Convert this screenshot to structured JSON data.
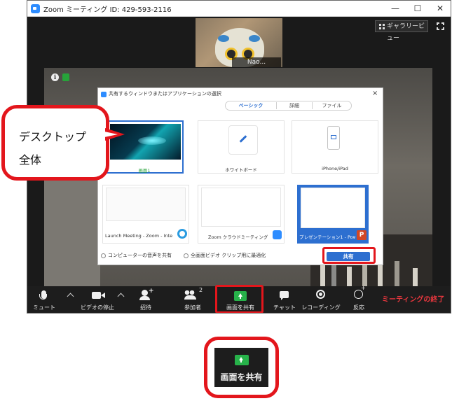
{
  "window": {
    "title": "Zoom ミーティング ID: 429-593-2116",
    "minimize": "—",
    "maximize": "☐",
    "close": "✕"
  },
  "gallery_view_label": "ギャラリービュー",
  "participant": {
    "name": "Nao..."
  },
  "share_dialog": {
    "title": "共有するウィンドウまたはアプリケーションの選択",
    "close": "×",
    "tabs": [
      "ベーシック",
      "詳細",
      "ファイル"
    ],
    "tiles": [
      {
        "label": "画面1"
      },
      {
        "label": "ホワイトボード"
      },
      {
        "label": "iPhone/iPad"
      },
      {
        "label": "Launch Meeting - Zoom - Intern..."
      },
      {
        "label": "Zoom クラウドミーティング"
      },
      {
        "label": "プレゼンテーション1 - Pow..."
      }
    ],
    "ppt_glyph": "P",
    "options": {
      "share_audio": "コンピューターの音声を共有",
      "optimize_video": "全画面ビデオ クリップ用に最適化"
    },
    "share_button": "共有"
  },
  "toolbar": {
    "mute": "ミュート",
    "stop_video": "ビデオの停止",
    "invite": "招待",
    "participants": "参加者",
    "participant_count": "2",
    "share_screen": "画面を共有",
    "chat": "チャット",
    "recording": "レコーディング",
    "reactions": "反応",
    "end_meeting": "ミーティングの終了"
  },
  "callout": {
    "line1": "デスクトップ",
    "line2": "全体"
  },
  "zoomed_callout": {
    "label": "画面を共有"
  },
  "colors": {
    "highlight": "#e3161c",
    "share_green": "#27b24a",
    "accent_blue": "#2d6fd0",
    "end_red": "#e8373e"
  }
}
